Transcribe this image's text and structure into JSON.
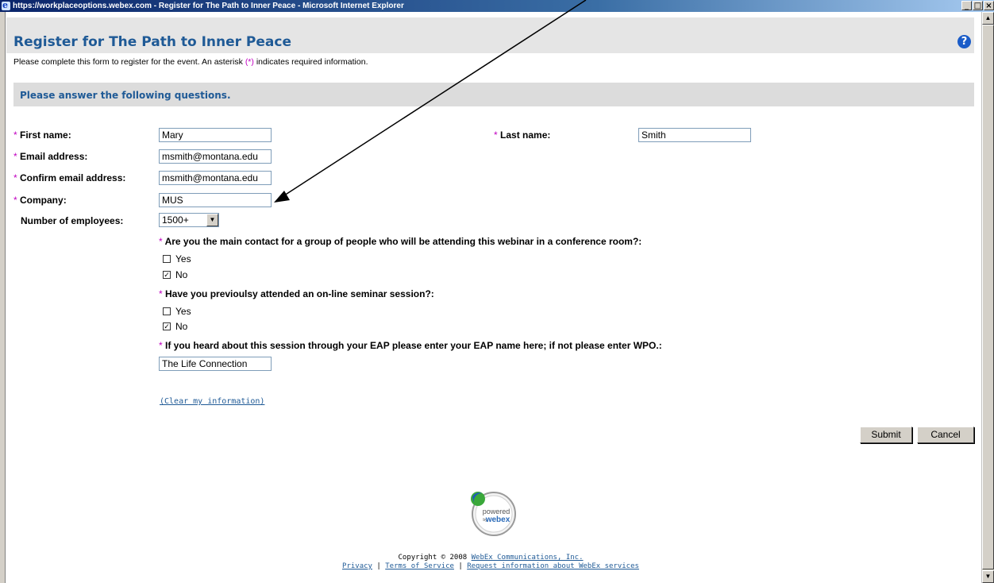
{
  "window": {
    "title": "https://workplaceoptions.webex.com - Register for The Path to Inner Peace - Microsoft Internet Explorer",
    "controls": [
      "_",
      "□",
      "×"
    ]
  },
  "page": {
    "title": "Register for The Path to Inner Peace",
    "intro_before": "Please complete this form to register for the event. An asterisk ",
    "intro_marker": "(*)",
    "intro_after": " indicates required information.",
    "help_icon": "?"
  },
  "section": {
    "title": "Please answer the following questions."
  },
  "required_marker": "*",
  "form": {
    "first_name": {
      "label": "First name:",
      "value": "Mary"
    },
    "last_name": {
      "label": "Last name:",
      "value": "Smith"
    },
    "email": {
      "label": "Email address:",
      "value": "msmith@montana.edu"
    },
    "confirm_email": {
      "label": "Confirm email address:",
      "value": "msmith@montana.edu"
    },
    "company": {
      "label": "Company:",
      "value": "MUS"
    },
    "employees": {
      "label": "Number of employees:",
      "value": "1500+"
    }
  },
  "questions": [
    {
      "text": "Are you the main contact for a group of people who will be attending this webinar in a conference room?:",
      "options": [
        {
          "label": "Yes",
          "checked": false
        },
        {
          "label": "No",
          "checked": true
        }
      ]
    },
    {
      "text": "Have you previoulsy attended an on-line seminar session?:",
      "options": [
        {
          "label": "Yes",
          "checked": false
        },
        {
          "label": "No",
          "checked": true
        }
      ]
    },
    {
      "text": "If you heard about this session through your EAP please enter your EAP name here; if not please enter WPO.:",
      "answer": "The Life Connection"
    }
  ],
  "clear_link": "(Clear my information)",
  "buttons": {
    "submit": "Submit",
    "cancel": "Cancel"
  },
  "logo": {
    "line1": "powered",
    "line2": "by",
    "line3": "webex"
  },
  "footer": {
    "copyright_prefix": "Copyright © 2008 ",
    "company_link": "WebEx Communications, Inc.",
    "privacy": "Privacy",
    "terms": "Terms of Service",
    "request": "Request information about WebEx services",
    "separator": " | "
  },
  "colors": {
    "title_blue": "#1f5a96",
    "required_magenta": "#c000c0",
    "band_gray": "#e5e5e5"
  }
}
